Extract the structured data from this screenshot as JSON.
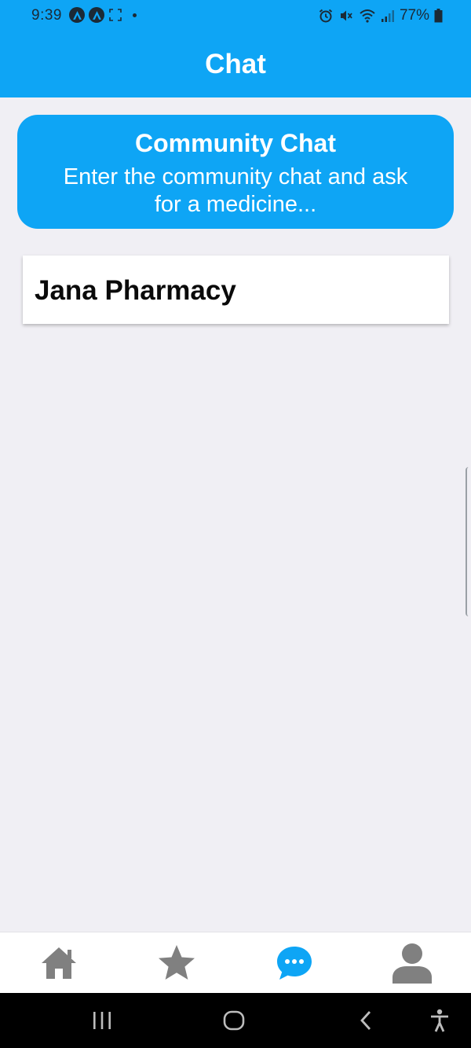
{
  "status_bar": {
    "time": "9:39",
    "battery": "77%",
    "icons": [
      "app-a-icon",
      "app-a-icon",
      "screenshot-icon",
      "dot-icon",
      "alarm-icon",
      "mute-icon",
      "wifi-icon",
      "signal-icon",
      "battery-icon"
    ]
  },
  "header": {
    "title": "Chat"
  },
  "community": {
    "title": "Community Chat",
    "description": "Enter the community chat and ask for a medicine..."
  },
  "chats": [
    {
      "name": "Jana Pharmacy"
    }
  ],
  "tabs": [
    {
      "icon": "home-icon",
      "active": false
    },
    {
      "icon": "star-icon",
      "active": false
    },
    {
      "icon": "chat-bubble-icon",
      "active": true
    },
    {
      "icon": "user-icon",
      "active": false
    }
  ],
  "system_nav": [
    "recents-icon",
    "home-circle-icon",
    "back-icon",
    "accessibility-icon"
  ],
  "colors": {
    "accent": "#0ea5f5",
    "background": "#f0eff4",
    "inactive_tab": "#808080",
    "text_dark": "#0a0a0a"
  }
}
